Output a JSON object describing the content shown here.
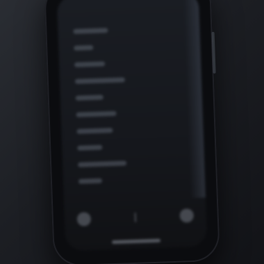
{
  "device": {
    "type": "smartphone",
    "colors": {
      "background": "#1c1e23",
      "frame": "#0b0c0f",
      "screen": "#15171c",
      "blurred_text": "#4a5059"
    }
  },
  "menu": {
    "items": [
      {
        "label": ""
      },
      {
        "label": ""
      },
      {
        "label": ""
      },
      {
        "label": ""
      },
      {
        "label": ""
      },
      {
        "label": ""
      },
      {
        "label": ""
      },
      {
        "label": ""
      },
      {
        "label": ""
      },
      {
        "label": ""
      }
    ]
  },
  "bottom_nav": {
    "left_icon": "circle-icon",
    "center_icon": "divider-icon",
    "right_icon": "circle-icon"
  }
}
